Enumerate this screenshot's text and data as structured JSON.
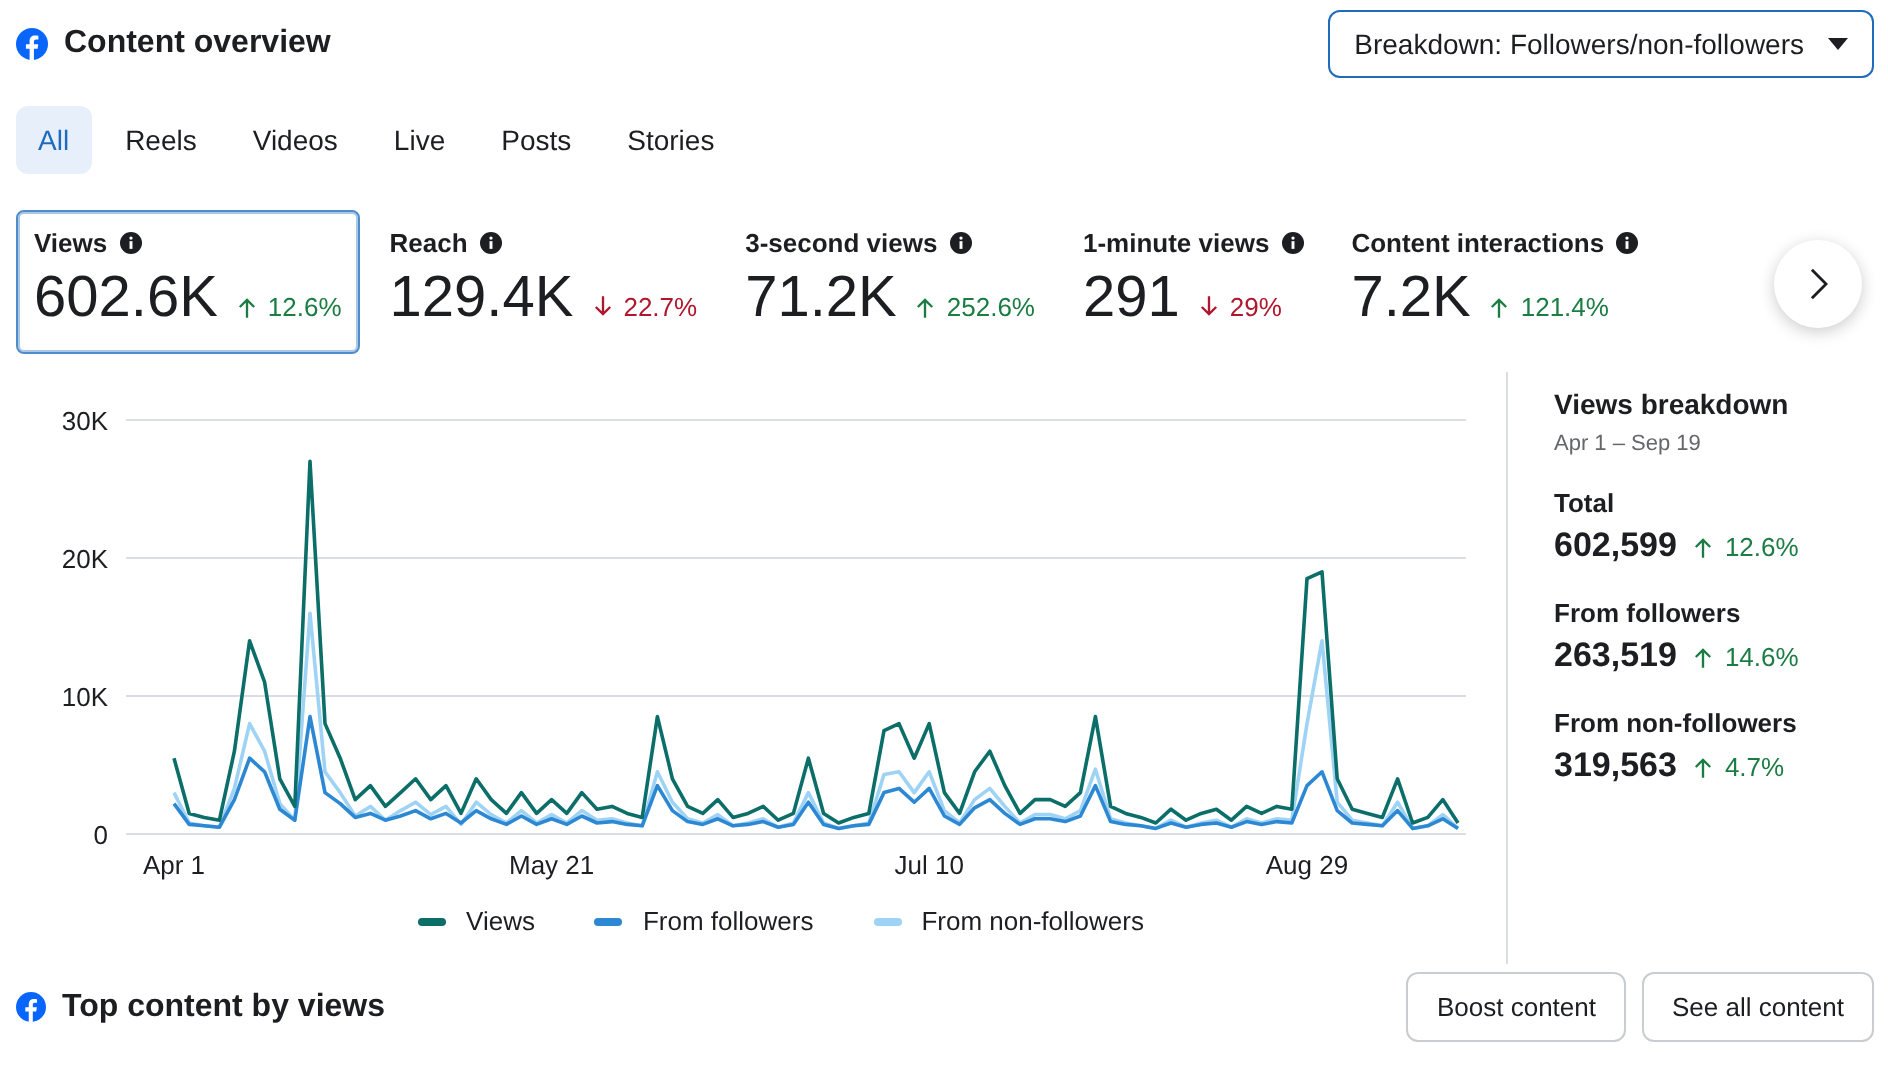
{
  "header": {
    "title": "Content overview",
    "breakdown": "Breakdown: Followers/non-followers"
  },
  "tabs": [
    {
      "label": "All",
      "selected": true
    },
    {
      "label": "Reels",
      "selected": false
    },
    {
      "label": "Videos",
      "selected": false
    },
    {
      "label": "Live",
      "selected": false
    },
    {
      "label": "Posts",
      "selected": false
    },
    {
      "label": "Stories",
      "selected": false
    }
  ],
  "metrics": [
    {
      "label": "Views",
      "value": "602.6K",
      "change": "12.6%",
      "kind": "up",
      "selected": true
    },
    {
      "label": "Reach",
      "value": "129.4K",
      "change": "22.7%",
      "kind": "down",
      "selected": false
    },
    {
      "label": "3-second views",
      "value": "71.2K",
      "change": "252.6%",
      "kind": "up",
      "selected": false
    },
    {
      "label": "1-minute views",
      "value": "291",
      "change": "29%",
      "kind": "down",
      "selected": false
    },
    {
      "label": "Content interactions",
      "value": "7.2K",
      "change": "121.4%",
      "kind": "up",
      "selected": false
    }
  ],
  "chart_data": {
    "type": "line",
    "categories": [
      "Apr 1",
      null,
      null,
      null,
      null,
      null,
      null,
      null,
      null,
      null,
      null,
      null,
      null,
      null,
      null,
      null,
      null,
      null,
      null,
      null,
      null,
      null,
      null,
      null,
      null,
      "May 21",
      null,
      null,
      null,
      null,
      null,
      null,
      null,
      null,
      null,
      null,
      null,
      null,
      null,
      null,
      null,
      null,
      null,
      null,
      null,
      null,
      null,
      null,
      null,
      null,
      "Jul 10",
      null,
      null,
      null,
      null,
      null,
      null,
      null,
      null,
      null,
      null,
      null,
      null,
      null,
      null,
      null,
      null,
      null,
      null,
      null,
      null,
      null,
      null,
      null,
      null,
      "Aug 29",
      null,
      null,
      null,
      null,
      null,
      null,
      null,
      null,
      null,
      null
    ],
    "yticks": [
      {
        "value": 0,
        "label": "0"
      },
      {
        "value": 10000,
        "label": "10K"
      },
      {
        "value": 20000,
        "label": "20K"
      },
      {
        "value": 30000,
        "label": "30K"
      }
    ],
    "ylim": [
      0,
      30000
    ],
    "series": [
      {
        "name": "Views",
        "color": "#0b6e69",
        "values": [
          5500,
          1500,
          1200,
          1000,
          6000,
          14000,
          11000,
          4000,
          2000,
          27000,
          8000,
          5500,
          2500,
          3500,
          2000,
          3000,
          4000,
          2500,
          3500,
          1500,
          4000,
          2500,
          1500,
          3000,
          1500,
          2500,
          1500,
          3000,
          1800,
          2000,
          1500,
          1200,
          8500,
          4000,
          2000,
          1500,
          2500,
          1200,
          1500,
          2000,
          1000,
          1500,
          5500,
          1500,
          800,
          1200,
          1500,
          7500,
          8000,
          5500,
          8000,
          3000,
          1500,
          4500,
          6000,
          3500,
          1500,
          2500,
          2500,
          2000,
          3000,
          8500,
          2000,
          1500,
          1200,
          800,
          1800,
          1000,
          1500,
          1800,
          1000,
          2000,
          1500,
          2000,
          1800,
          18500,
          19000,
          4000,
          1800,
          1500,
          1200,
          4000,
          800,
          1200,
          2500,
          800
        ]
      },
      {
        "name": "From followers",
        "color": "#2d88d3",
        "values": [
          2200,
          700,
          600,
          500,
          2500,
          5500,
          4500,
          1800,
          1000,
          8500,
          3000,
          2200,
          1200,
          1500,
          1000,
          1300,
          1700,
          1100,
          1500,
          800,
          1700,
          1100,
          700,
          1300,
          700,
          1100,
          700,
          1300,
          800,
          900,
          700,
          600,
          3500,
          1700,
          900,
          700,
          1100,
          600,
          700,
          900,
          500,
          700,
          2300,
          700,
          400,
          600,
          700,
          3000,
          3300,
          2300,
          3300,
          1300,
          700,
          1900,
          2500,
          1500,
          700,
          1100,
          1100,
          900,
          1300,
          3500,
          900,
          700,
          600,
          400,
          800,
          500,
          700,
          800,
          500,
          900,
          700,
          900,
          800,
          3500,
          4500,
          1700,
          800,
          700,
          600,
          1700,
          400,
          600,
          1100,
          400
        ]
      },
      {
        "name": "From non-followers",
        "color": "#9fd3f5",
        "values": [
          3000,
          800,
          600,
          500,
          3300,
          8000,
          6000,
          2200,
          1000,
          16000,
          4500,
          3000,
          1300,
          2000,
          1000,
          1700,
          2300,
          1400,
          2000,
          700,
          2300,
          1400,
          800,
          1700,
          800,
          1400,
          800,
          1700,
          1000,
          1100,
          800,
          600,
          4500,
          2300,
          1100,
          800,
          1400,
          600,
          800,
          1100,
          500,
          800,
          3000,
          800,
          400,
          600,
          800,
          4300,
          4500,
          3000,
          4500,
          1700,
          800,
          2500,
          3300,
          2000,
          800,
          1400,
          1400,
          1100,
          1700,
          4700,
          1100,
          800,
          600,
          400,
          1000,
          500,
          800,
          1000,
          500,
          1100,
          800,
          1100,
          1000,
          8000,
          14000,
          2300,
          1000,
          800,
          600,
          2300,
          400,
          600,
          1400,
          400
        ]
      }
    ]
  },
  "breakdown": {
    "title": "Views breakdown",
    "range": "Apr 1 – Sep 19",
    "rows": [
      {
        "label": "Total",
        "value": "602,599",
        "change": "12.6%",
        "kind": "up"
      },
      {
        "label": "From followers",
        "value": "263,519",
        "change": "14.6%",
        "kind": "up"
      },
      {
        "label": "From non-followers",
        "value": "319,563",
        "change": "4.7%",
        "kind": "up"
      }
    ]
  },
  "footer": {
    "title": "Top content by views",
    "buttons": [
      "Boost content",
      "See all content"
    ]
  }
}
